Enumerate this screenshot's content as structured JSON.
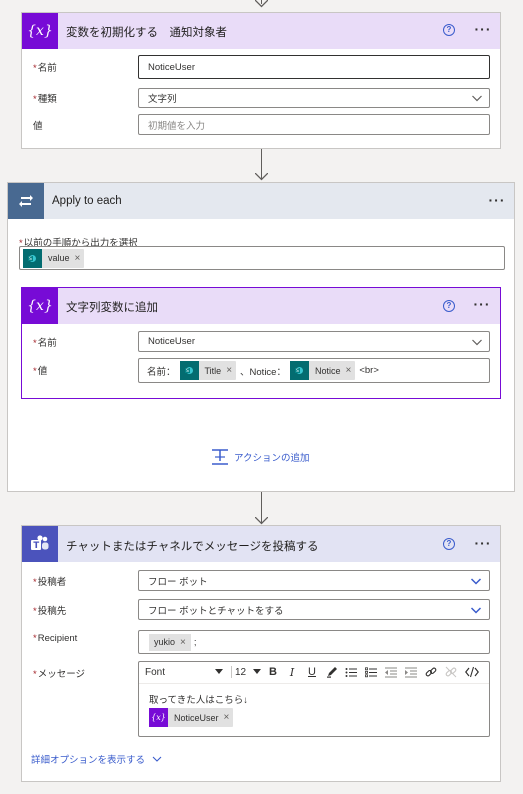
{
  "init_card": {
    "title": "変数を初期化する　通知対象者",
    "help": "?",
    "more": "···",
    "name_label": "名前",
    "name_value": "NoticeUser",
    "type_label": "種類",
    "type_value": "文字列",
    "value_label": "値",
    "value_placeholder": "初期値を入力",
    "accent": "#770bd6",
    "header_bg": "#e9dcf8"
  },
  "apply_card": {
    "title": "Apply to each",
    "more": "···",
    "select_label": "以前の手順から出力を選択",
    "token_value": "value",
    "token_close": "×",
    "add_action": "アクションの追加",
    "accent": "#486991",
    "header_bg": "#e4e8ef"
  },
  "append_card": {
    "title": "文字列変数に追加",
    "help": "?",
    "more": "···",
    "name_label": "名前",
    "name_value": "NoticeUser",
    "value_label": "値",
    "text_prefix": "名前：",
    "token_title": "Title",
    "text_mid": "、Notice：",
    "token_notice": "Notice",
    "text_suffix": "<br>",
    "token_close": "×"
  },
  "teams_card": {
    "title": "チャットまたはチャネルでメッセージを投稿する",
    "help": "?",
    "more": "···",
    "poster_label": "投稿者",
    "poster_value": "フロー ボット",
    "post_to_label": "投稿先",
    "post_to_value": "フロー ボットとチャットをする",
    "recipient_label": "Recipient",
    "recipient_token": "yukio",
    "recipient_suffix": ";",
    "message_label": "メッセージ",
    "font_label": "Font",
    "font_size": "12",
    "bold": "B",
    "italic": "I",
    "underline": "U",
    "message_text": "取ってきた人はこちら↓",
    "message_token": "NoticeUser",
    "token_close": "×",
    "advanced_link": "詳細オプションを表示する",
    "accent": "#4b53bc",
    "header_bg": "#e2e3f3"
  },
  "icons": {
    "variable": "variable-icon",
    "loop": "loop-icon",
    "sharepoint": "sharepoint-icon",
    "teams": "teams-icon"
  }
}
